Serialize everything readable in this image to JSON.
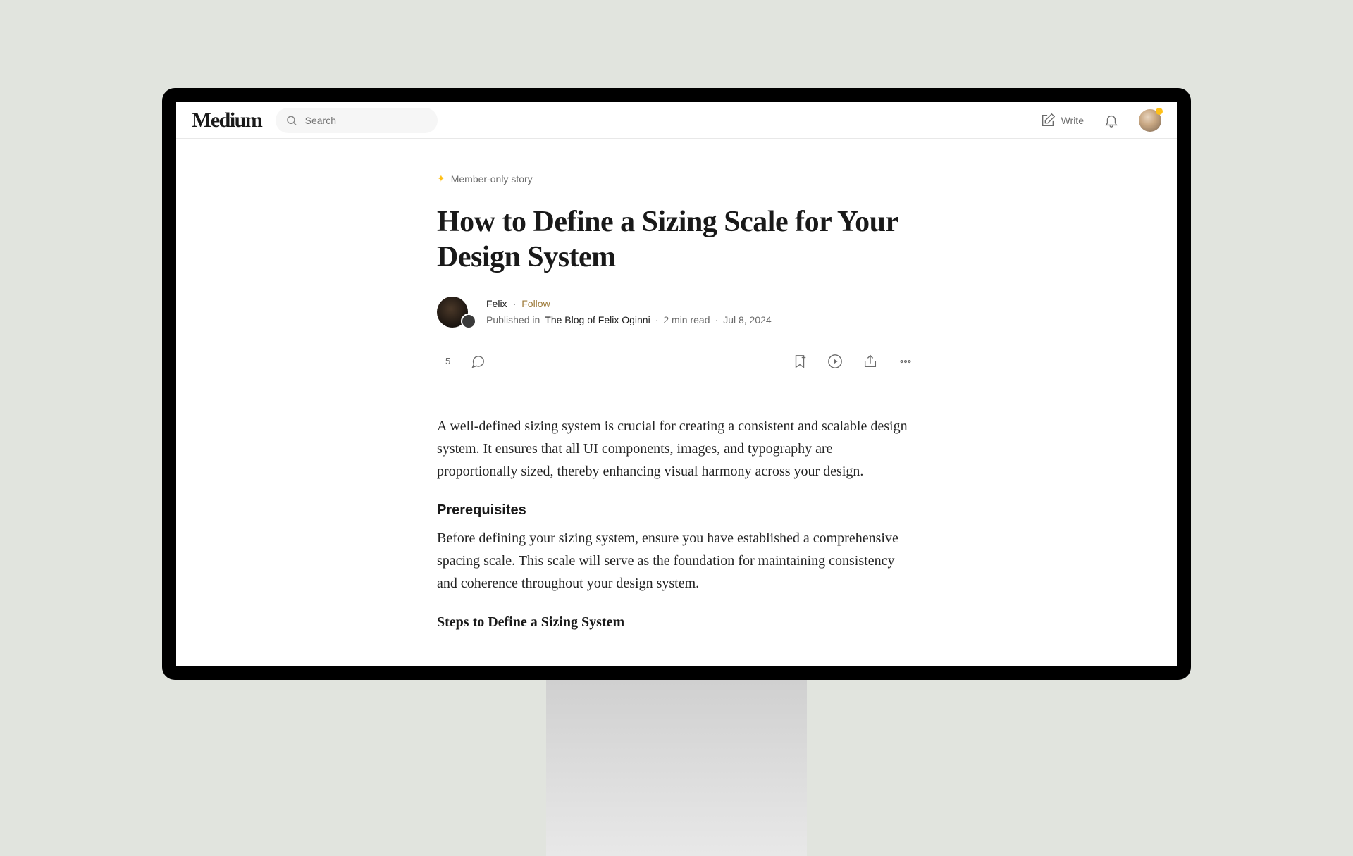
{
  "header": {
    "logo": "Medium",
    "search_placeholder": "Search",
    "write_label": "Write"
  },
  "article": {
    "member_badge": "Member-only story",
    "title": "How to Define a Sizing Scale for Your Design System",
    "author": {
      "name": "Felix",
      "follow": "Follow",
      "published_in_prefix": "Published in",
      "publication": "The Blog of Felix Oginni",
      "read_time": "2 min read",
      "date": "Jul 8, 2024"
    },
    "stats": {
      "claps": "5"
    },
    "body": {
      "intro": "A well-defined sizing system is crucial for creating a consistent and scalable design system. It ensures that all UI components, images, and typography are proportionally sized, thereby enhancing visual harmony across your design.",
      "h_prereq": "Prerequisites",
      "prereq_text": "Before defining your sizing system, ensure you have established a comprehensive spacing scale. This scale will serve as the foundation for maintaining consistency and coherence throughout your design system.",
      "h_steps": "Steps to Define a Sizing System"
    }
  }
}
